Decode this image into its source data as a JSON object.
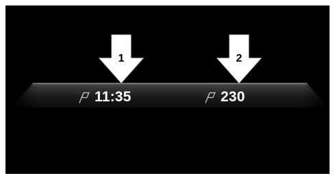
{
  "status_bar": {
    "arrival_time": "11:35",
    "distance": "230",
    "arrival_icon": "destination-flag-icon",
    "distance_icon": "destination-flag-icon"
  },
  "callouts": [
    {
      "label": "1",
      "icon": "down-arrow-icon"
    },
    {
      "label": "2",
      "icon": "down-arrow-icon"
    }
  ],
  "colors": {
    "background": "#000000",
    "bar_top": "#5a5a5a",
    "bar_bottom": "#111111",
    "text": "#ffffff",
    "arrow": "#ffffff"
  }
}
